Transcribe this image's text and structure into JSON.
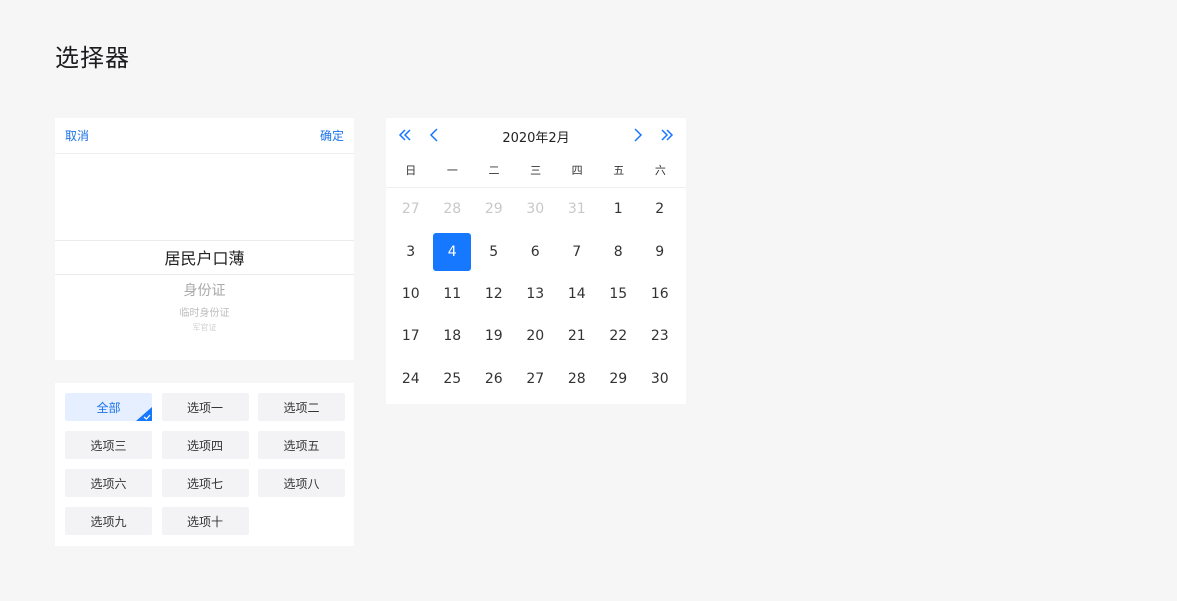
{
  "page": {
    "title": "选择器"
  },
  "picker": {
    "cancel_label": "取消",
    "confirm_label": "确定",
    "selected": "居民户口薄",
    "next_options": [
      "身份证",
      "临时身份证",
      "军官证"
    ]
  },
  "tags": {
    "items": [
      "全部",
      "选项一",
      "选项二",
      "选项三",
      "选项四",
      "选项五",
      "选项六",
      "选项七",
      "选项八",
      "选项九",
      "选项十"
    ],
    "active": "全部"
  },
  "calendar": {
    "title": "2020年2月",
    "weekdays": [
      "日",
      "一",
      "二",
      "三",
      "四",
      "五",
      "六"
    ],
    "days": [
      {
        "label": "27",
        "muted": true
      },
      {
        "label": "28",
        "muted": true
      },
      {
        "label": "29",
        "muted": true
      },
      {
        "label": "30",
        "muted": true
      },
      {
        "label": "31",
        "muted": true
      },
      {
        "label": "1"
      },
      {
        "label": "2"
      },
      {
        "label": "3"
      },
      {
        "label": "4",
        "selected": true
      },
      {
        "label": "5"
      },
      {
        "label": "6"
      },
      {
        "label": "7"
      },
      {
        "label": "8"
      },
      {
        "label": "9"
      },
      {
        "label": "10"
      },
      {
        "label": "11"
      },
      {
        "label": "12"
      },
      {
        "label": "13"
      },
      {
        "label": "14"
      },
      {
        "label": "15"
      },
      {
        "label": "16"
      },
      {
        "label": "17"
      },
      {
        "label": "18"
      },
      {
        "label": "19"
      },
      {
        "label": "20"
      },
      {
        "label": "21"
      },
      {
        "label": "22"
      },
      {
        "label": "23"
      },
      {
        "label": "24"
      },
      {
        "label": "25"
      },
      {
        "label": "26"
      },
      {
        "label": "27"
      },
      {
        "label": "28"
      },
      {
        "label": "29"
      },
      {
        "label": "30"
      }
    ],
    "accent": "#1677ff"
  }
}
